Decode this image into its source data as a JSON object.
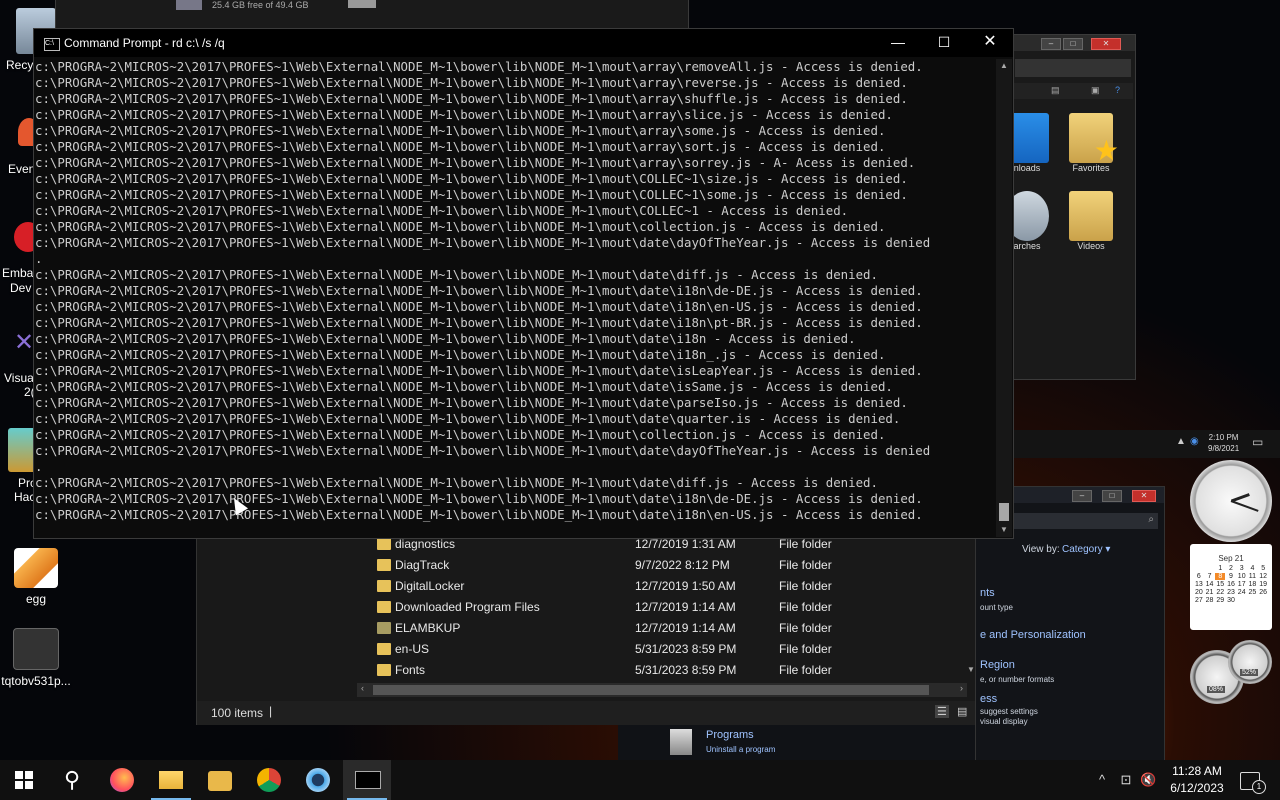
{
  "desktop": {
    "icons": [
      {
        "label": "egg"
      },
      {
        "label": "tqtobv531p..."
      }
    ],
    "edge_labels": [
      "Recyc",
      "Even",
      "Embac",
      "Dev",
      "Visual",
      "2(",
      "Pro",
      "Hac"
    ]
  },
  "bg_window_top": {
    "drive_text": "25.4 GB free of 49.4 GB",
    "folders": [
      "nloads",
      "Favorites",
      "arches",
      "Videos"
    ]
  },
  "cmd": {
    "title": "Command Prompt - rd  c:\\ /s /q",
    "lines": [
      "c:\\PROGRA~2\\MICROS~2\\2017\\PROFES~1\\Web\\External\\NODE_M~1\\bower\\lib\\NODE_M~1\\mout\\array\\removeAll.js - Access is denied.",
      "c:\\PROGRA~2\\MICROS~2\\2017\\PROFES~1\\Web\\External\\NODE_M~1\\bower\\lib\\NODE_M~1\\mout\\array\\reverse.js - Access is denied.",
      "c:\\PROGRA~2\\MICROS~2\\2017\\PROFES~1\\Web\\External\\NODE_M~1\\bower\\lib\\NODE_M~1\\mout\\array\\shuffle.js - Access is denied.",
      "c:\\PROGRA~2\\MICROS~2\\2017\\PROFES~1\\Web\\External\\NODE_M~1\\bower\\lib\\NODE_M~1\\mout\\array\\slice.js - Access is denied.",
      "c:\\PROGRA~2\\MICROS~2\\2017\\PROFES~1\\Web\\External\\NODE_M~1\\bower\\lib\\NODE_M~1\\mout\\array\\some.js - Access is denied.",
      "c:\\PROGRA~2\\MICROS~2\\2017\\PROFES~1\\Web\\External\\NODE_M~1\\bower\\lib\\NODE_M~1\\mout\\array\\sort.js - Access is denied.",
      "c:\\PROGRA~2\\MICROS~2\\2017\\PROFES~1\\Web\\External\\NODE_M~1\\bower\\lib\\NODE_M~1\\mout\\array\\sorrey.js - A- Acess is denied.",
      "c:\\PROGRA~2\\MICROS~2\\2017\\PROFES~1\\Web\\External\\NODE_M~1\\bower\\lib\\NODE_M~1\\mout\\COLLEC~1\\size.js - Access is denied.",
      "c:\\PROGRA~2\\MICROS~2\\2017\\PROFES~1\\Web\\External\\NODE_M~1\\bower\\lib\\NODE_M~1\\mout\\COLLEC~1\\some.js - Access is denied.",
      "c:\\PROGRA~2\\MICROS~2\\2017\\PROFES~1\\Web\\External\\NODE_M~1\\bower\\lib\\NODE_M~1\\mout\\COLLEC~1 - Access is denied.",
      "c:\\PROGRA~2\\MICROS~2\\2017\\PROFES~1\\Web\\External\\NODE_M~1\\bower\\lib\\NODE_M~1\\mout\\collection.js - Access is denied.",
      "c:\\PROGRA~2\\MICROS~2\\2017\\PROFES~1\\Web\\External\\NODE_M~1\\bower\\lib\\NODE_M~1\\mout\\date\\dayOfTheYear.js - Access is denied",
      ".",
      "c:\\PROGRA~2\\MICROS~2\\2017\\PROFES~1\\Web\\External\\NODE_M~1\\bower\\lib\\NODE_M~1\\mout\\date\\diff.js - Access is denied.",
      "c:\\PROGRA~2\\MICROS~2\\2017\\PROFES~1\\Web\\External\\NODE_M~1\\bower\\lib\\NODE_M~1\\mout\\date\\i18n\\de-DE.js - Access is denied.",
      "c:\\PROGRA~2\\MICROS~2\\2017\\PROFES~1\\Web\\External\\NODE_M~1\\bower\\lib\\NODE_M~1\\mout\\date\\i18n\\en-US.js - Access is denied.",
      "c:\\PROGRA~2\\MICROS~2\\2017\\PROFES~1\\Web\\External\\NODE_M~1\\bower\\lib\\NODE_M~1\\mout\\date\\i18n\\pt-BR.js - Access is denied.",
      "c:\\PROGRA~2\\MICROS~2\\2017\\PROFES~1\\Web\\External\\NODE_M~1\\bower\\lib\\NODE_M~1\\mout\\date\\i18n - Access is denied.",
      "c:\\PROGRA~2\\MICROS~2\\2017\\PROFES~1\\Web\\External\\NODE_M~1\\bower\\lib\\NODE_M~1\\mout\\date\\i18n_.js - Access is denied.",
      "c:\\PROGRA~2\\MICROS~2\\2017\\PROFES~1\\Web\\External\\NODE_M~1\\bower\\lib\\NODE_M~1\\mout\\date\\isLeapYear.js - Access is denied.",
      "c:\\PROGRA~2\\MICROS~2\\2017\\PROFES~1\\Web\\External\\NODE_M~1\\bower\\lib\\NODE_M~1\\mout\\date\\isSame.js - Access is denied.",
      "c:\\PROGRA~2\\MICROS~2\\2017\\PROFES~1\\Web\\External\\NODE_M~1\\bower\\lib\\NODE_M~1\\mout\\date\\parseIso.js - Access is denied.",
      "c:\\PROGRA~2\\MICROS~2\\2017\\PROFES~1\\Web\\External\\NODE_M~1\\bower\\lib\\NODE_M~1\\mout\\date\\quarter.is - Access is denied.",
      "c:\\PROGRA~2\\MICROS~2\\2017\\PROFES~1\\Web\\External\\NODE_M~1\\bower\\lib\\NODE_M~1\\mout\\collection.js - Access is denied.",
      "c:\\PROGRA~2\\MICROS~2\\2017\\PROFES~1\\Web\\External\\NODE_M~1\\bower\\lib\\NODE_M~1\\mout\\date\\dayOfTheYear.js - Access is denied",
      ".",
      "c:\\PROGRA~2\\MICROS~2\\2017\\PROFES~1\\Web\\External\\NODE_M~1\\bower\\lib\\NODE_M~1\\mout\\date\\diff.js - Access is denied.",
      "c:\\PROGRA~2\\MICROS~2\\2017\\PROFES~1\\Web\\External\\NODE_M~1\\bower\\lib\\NODE_M~1\\mout\\date\\i18n\\de-DE.js - Access is denied.",
      "c:\\PROGRA~2\\MICROS~2\\2017\\PROFES~1\\Web\\External\\NODE_M~1\\bower\\lib\\NODE_M~1\\mout\\date\\i18n\\en-US.js - Access is denied."
    ]
  },
  "explorer": {
    "rows": [
      {
        "name": "diagnostics",
        "date": "12/7/2019 1:31 AM",
        "type": "File folder"
      },
      {
        "name": "DiagTrack",
        "date": "9/7/2022 8:12 PM",
        "type": "File folder"
      },
      {
        "name": "DigitalLocker",
        "date": "12/7/2019 1:50 AM",
        "type": "File folder"
      },
      {
        "name": "Downloaded Program Files",
        "date": "12/7/2019 1:14 AM",
        "type": "File folder"
      },
      {
        "name": "ELAMBKUP",
        "date": "12/7/2019 1:14 AM",
        "type": "File folder"
      },
      {
        "name": "en-US",
        "date": "5/31/2023 8:59 PM",
        "type": "File folder"
      },
      {
        "name": "Fonts",
        "date": "5/31/2023 8:59 PM",
        "type": "File folder"
      }
    ],
    "status": "100 items"
  },
  "control_panel": {
    "view_by": "View by:",
    "view_value": "Category ▾",
    "lines": [
      "nts",
      "ount type",
      "e and Personalization",
      "Region",
      "e, or number formats",
      "ess",
      "suggest settings",
      "visual display"
    ],
    "programs": "Programs",
    "uninstall": "Uninstall a program"
  },
  "bg_tray": {
    "time": "2:10 PM",
    "date": "9/8/2021"
  },
  "calendar": {
    "month": "Sep 21",
    "days": [
      "",
      "",
      "1",
      "2",
      "3",
      "4",
      "5",
      "6",
      "7",
      "8",
      "9",
      "10",
      "11",
      "12",
      "13",
      "14",
      "15",
      "16",
      "17",
      "18",
      "19",
      "20",
      "21",
      "22",
      "23",
      "24",
      "25",
      "26",
      "27",
      "28",
      "29",
      "30"
    ],
    "today": "8"
  },
  "meter": {
    "cpu": "08%",
    "ram": "52%"
  },
  "taskbar": {
    "time": "11:28 AM",
    "date": "6/12/2023",
    "notif_count": "1"
  }
}
